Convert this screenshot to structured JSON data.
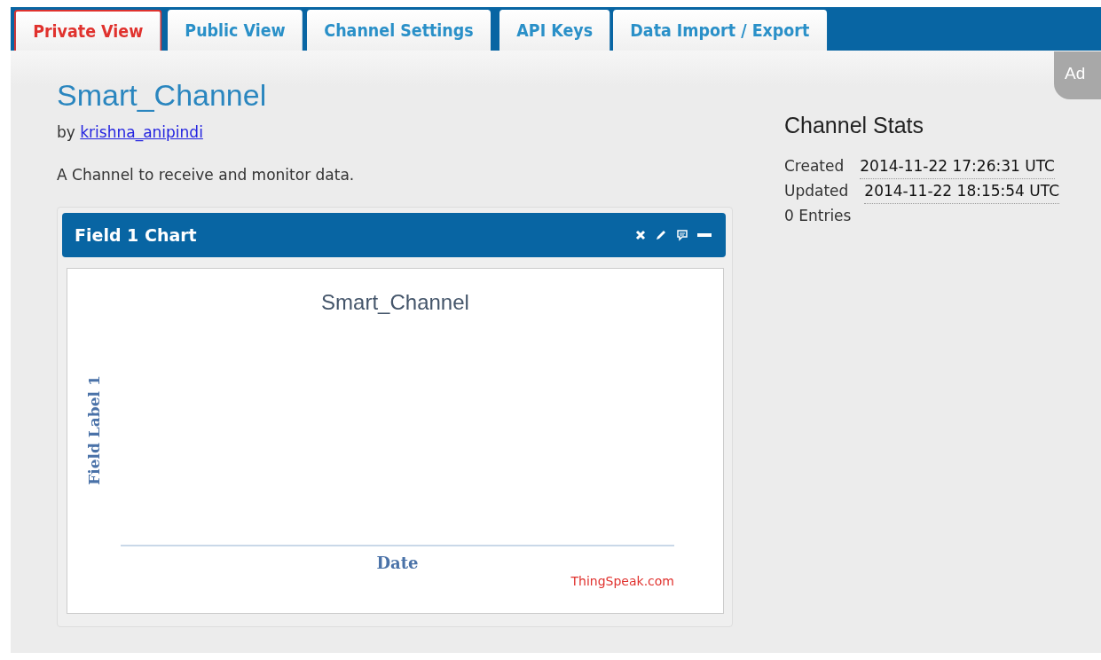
{
  "tabs": [
    {
      "label": "Private View",
      "selected": true
    },
    {
      "label": "Public View",
      "selected": false
    },
    {
      "label": "Channel Settings",
      "selected": false
    },
    {
      "label": "API Keys",
      "selected": false
    },
    {
      "label": "Data Import / Export",
      "selected": false
    }
  ],
  "side_tab": {
    "label": "Ad"
  },
  "channel": {
    "name": "Smart_Channel",
    "by": "by",
    "author": "krishna_anipindi",
    "description": "A Channel to receive and monitor data."
  },
  "stats": {
    "title": "Channel Stats",
    "rows": [
      {
        "label": "Created",
        "value": "2014-11-22 17:26:31 UTC"
      },
      {
        "label": "Updated",
        "value": "2014-11-22 18:15:54 UTC"
      }
    ],
    "entries": "0 Entries"
  },
  "chart_panel": {
    "title": "Field 1 Chart",
    "chart_title": "Smart_Channel",
    "ylabel": "Field Label 1",
    "xlabel": "Date",
    "credit": "ThingSpeak.com"
  }
}
